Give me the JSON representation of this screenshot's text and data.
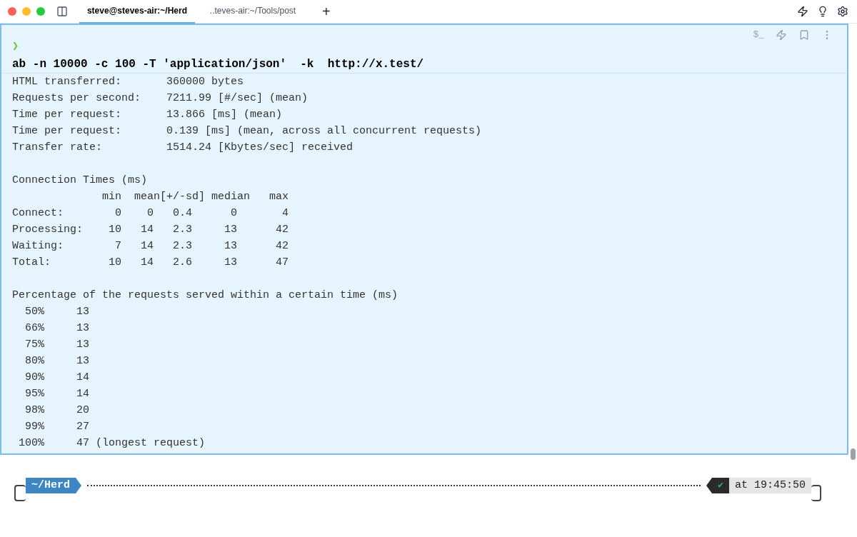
{
  "tabs": [
    {
      "label": "steve@steves-air:~/Herd",
      "selected": true
    },
    {
      "label": "..teves-air:~/Tools/post",
      "selected": false
    }
  ],
  "new_tab": "+",
  "block": {
    "prompt_symbol": "❯",
    "toolbar_text": "$_",
    "command": "ab -n 10000 -c 100 -T 'application/json'  -k  http://x.test/",
    "sections": [
      {
        "lines": [
          "HTML transferred:       360000 bytes",
          "Requests per second:    7211.99 [#/sec] (mean)",
          "Time per request:       13.866 [ms] (mean)",
          "Time per request:       0.139 [ms] (mean, across all concurrent requests)",
          "Transfer rate:          1514.24 [Kbytes/sec] received"
        ]
      },
      {
        "lines": [
          "Connection Times (ms)",
          "              min  mean[+/-sd] median   max",
          "Connect:        0    0   0.4      0       4",
          "Processing:    10   14   2.3     13      42",
          "Waiting:        7   14   2.3     13      42",
          "Total:         10   14   2.6     13      47"
        ]
      },
      {
        "lines": [
          "Percentage of the requests served within a certain time (ms)",
          "  50%     13",
          "  66%     13",
          "  75%     13",
          "  80%     13",
          "  90%     14",
          "  95%     14",
          "  98%     20",
          "  99%     27",
          " 100%     47 (longest request)"
        ]
      }
    ]
  },
  "prompt": {
    "directory": "~/Herd",
    "status": "✔",
    "time": "at 19:45:50"
  }
}
